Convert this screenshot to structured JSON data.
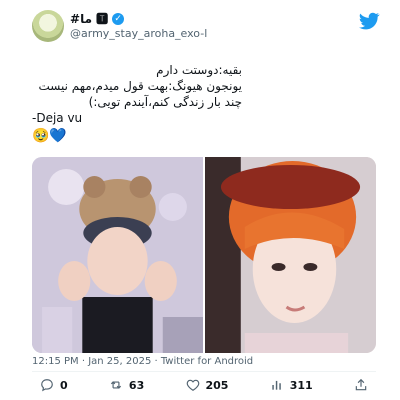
{
  "author": {
    "display_name": "#ما 🆃",
    "verified_mark": "✓",
    "handle": "@army_stay_aroha_exo-l"
  },
  "tweet": {
    "lines": [
      "بقیه:دوستت دارم",
      "یونجون هیونگ:بهت قول میدم،مهم نیست",
      "چند بار زندگی کنم،آیندم تویی:)",
      "-Deja vu"
    ],
    "emoji": "🥹💙"
  },
  "meta": {
    "timestamp": "12:15 PM · Jan 25, 2025 · Twitter for Android"
  },
  "actions": {
    "replies": "0",
    "retweets": "63",
    "likes": "205",
    "views": "311"
  },
  "colors": {
    "brand": "#1d9bf0",
    "text": "#0f1419",
    "muted": "#536471"
  }
}
